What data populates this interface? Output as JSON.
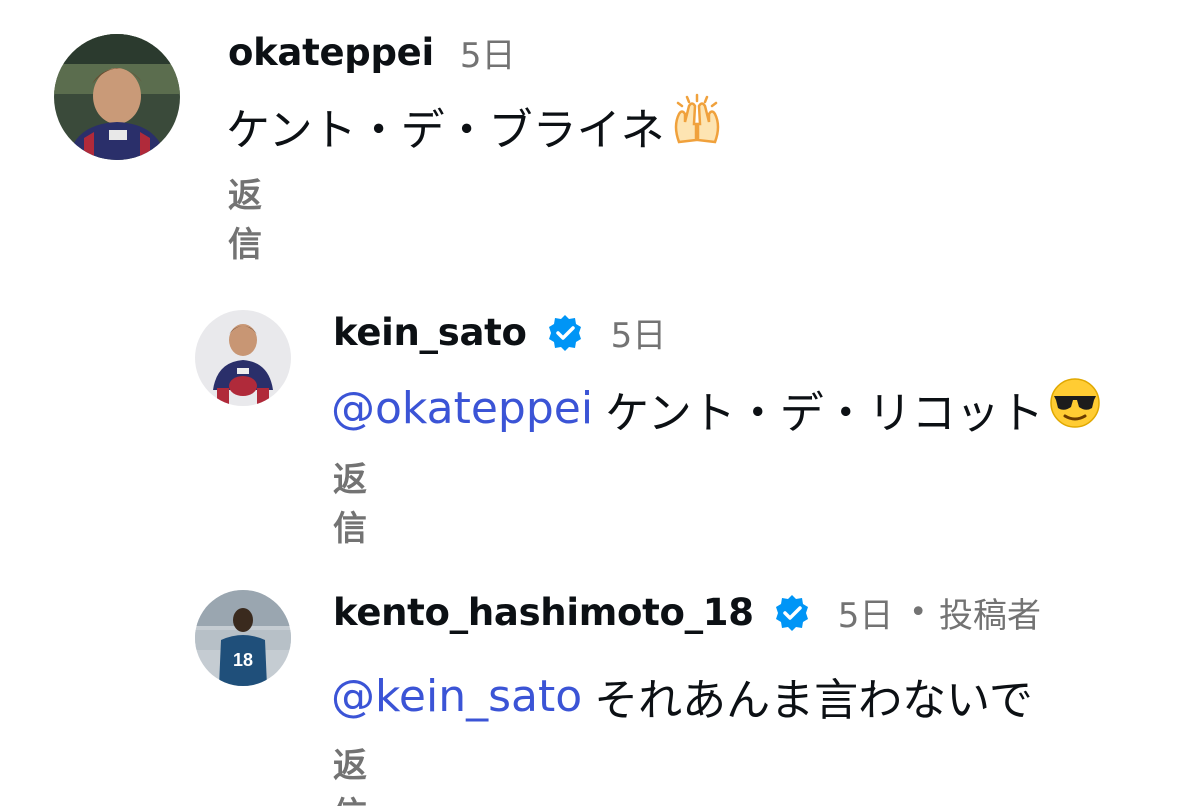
{
  "comments": [
    {
      "username": "okateppei",
      "time": "5日",
      "mention": "",
      "text": "ケント・デ・ブライネ",
      "emoji_icon": "raised-hands-icon",
      "reply_label": "返信",
      "verified": false
    },
    {
      "username": "kein_sato",
      "time": "5日",
      "mention": "@okateppei",
      "text": "ケント・デ・リコット",
      "emoji_icon": "sunglasses-face-icon",
      "reply_label": "返信",
      "verified": true
    },
    {
      "username": "kento_hashimoto_18",
      "time": "5日",
      "dot": "•",
      "author_tag": "投稿者",
      "mention": "@kein_sato",
      "text": "それあんま言わないで",
      "reply_label": "返信",
      "verified": true
    }
  ],
  "colors": {
    "mention": "#3b54d6",
    "verified": "#0095f6",
    "secondary_text": "#737373"
  }
}
